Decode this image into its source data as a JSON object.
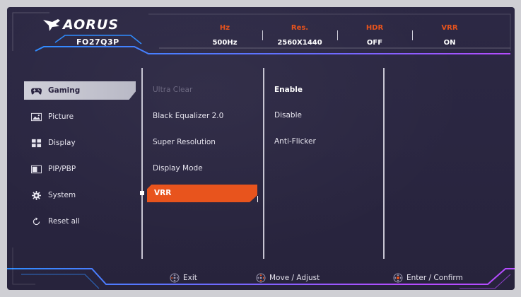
{
  "brand": {
    "name": "AORUS",
    "model": "FO27Q3P"
  },
  "status": [
    {
      "label": "Hz",
      "value": "500Hz"
    },
    {
      "label": "Res.",
      "value": "2560X1440"
    },
    {
      "label": "HDR",
      "value": "OFF"
    },
    {
      "label": "VRR",
      "value": "ON"
    }
  ],
  "sidebar": {
    "items": [
      {
        "label": "Gaming",
        "icon": "gamepad-icon",
        "active": true
      },
      {
        "label": "Picture",
        "icon": "picture-icon"
      },
      {
        "label": "Display",
        "icon": "display-grid-icon"
      },
      {
        "label": "PIP/PBP",
        "icon": "pip-icon"
      },
      {
        "label": "System",
        "icon": "gear-icon"
      },
      {
        "label": "Reset all",
        "icon": "reset-icon"
      }
    ]
  },
  "options": {
    "items": [
      {
        "label": "Ultra Clear",
        "disabled": true
      },
      {
        "label": "Black Equalizer 2.0"
      },
      {
        "label": "Super Resolution"
      },
      {
        "label": "Display Mode"
      },
      {
        "label": "VRR",
        "selected": true
      }
    ]
  },
  "values": {
    "items": [
      {
        "label": "Enable",
        "selected": true
      },
      {
        "label": "Disable"
      },
      {
        "label": "Anti-Flicker"
      }
    ]
  },
  "footer": {
    "exit": "Exit",
    "move": "Move / Adjust",
    "enter": "Enter / Confirm"
  },
  "colors": {
    "accent": "#e8541d",
    "status_label": "#e8531c",
    "neon_blue": "#2f8cff",
    "neon_purple": "#b54cff",
    "background": "#2a2641"
  }
}
